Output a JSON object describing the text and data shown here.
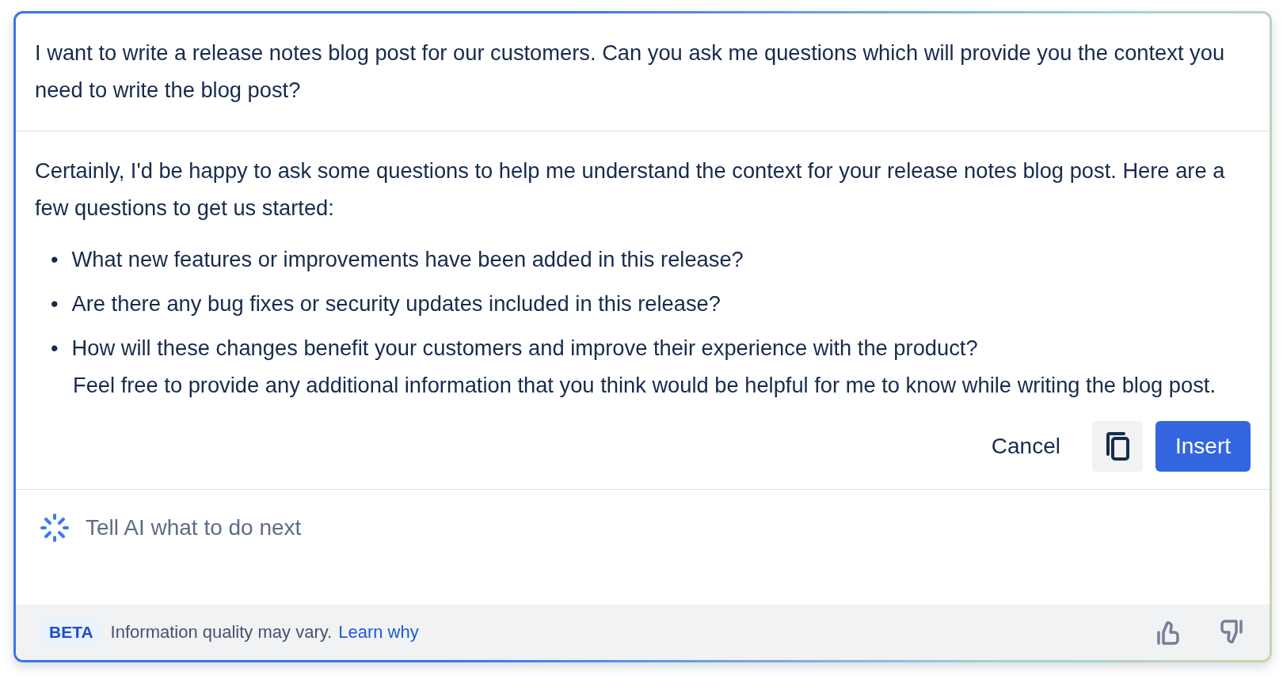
{
  "prompt": "I want to write a release notes blog post for our customers. Can you ask me questions which will provide you the context you need to write the blog post?",
  "response": {
    "intro": "Certainly, I'd be happy to ask some questions to help me understand the context for your release notes blog post. Here are a few questions to get us started:",
    "bullets": [
      {
        "marker": "•",
        "text": "What new features or improvements have been added in this release?"
      },
      {
        "marker": "•",
        "text": "Are there any bug fixes or security updates included in this release?"
      },
      {
        "marker": "•",
        "text": "How will these changes benefit your customers and improve their experience with the product?"
      }
    ],
    "note": "Feel free to provide any additional information that you think would be helpful for me to know while writing the blog post."
  },
  "actions": {
    "cancel": "Cancel",
    "insert": "Insert"
  },
  "input": {
    "placeholder": "Tell AI what to do next"
  },
  "footer": {
    "badge": "BETA",
    "message": "Information quality may vary.",
    "link": "Learn why"
  }
}
